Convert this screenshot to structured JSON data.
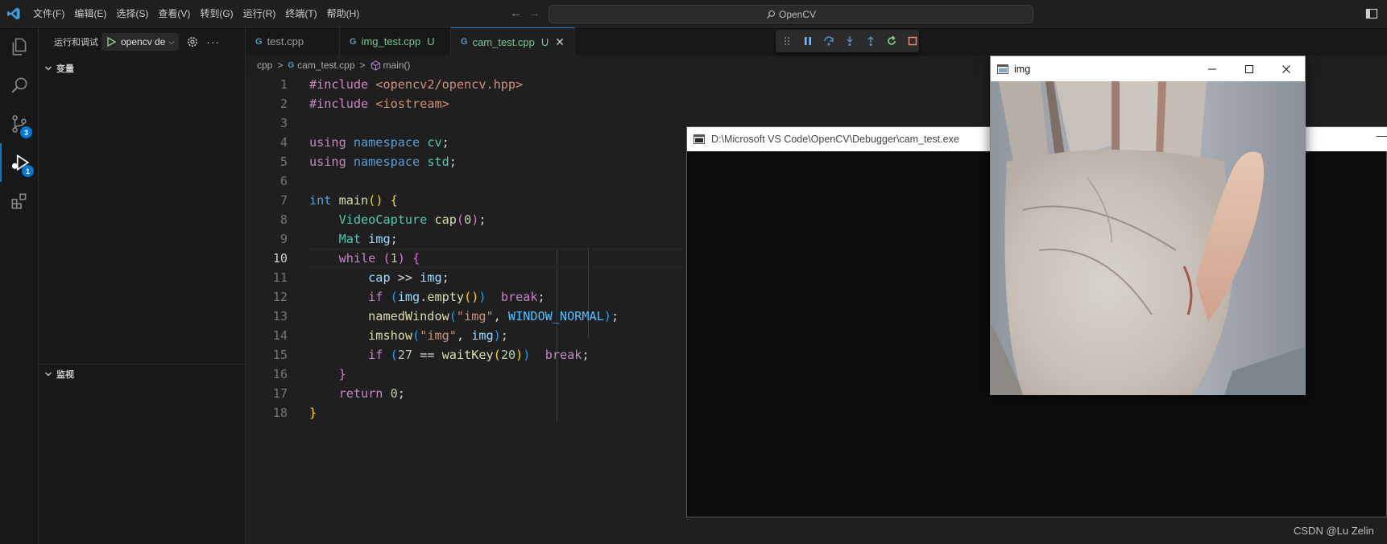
{
  "titlebar": {
    "menu": [
      "文件(F)",
      "编辑(E)",
      "选择(S)",
      "查看(V)",
      "转到(G)",
      "运行(R)",
      "终端(T)",
      "帮助(H)"
    ],
    "search_text": "OpenCV"
  },
  "activity_bar": {
    "source_control_badge": "3",
    "debug_badge": "1"
  },
  "sidebar": {
    "run_title": "运行和调试",
    "config_name": "opencv de",
    "variables_label": "变量",
    "watch_label": "监视"
  },
  "tabs": [
    {
      "name": "test.cpp",
      "modified": ""
    },
    {
      "name": "img_test.cpp",
      "modified": "U"
    },
    {
      "name": "cam_test.cpp",
      "modified": "U"
    }
  ],
  "breadcrumb": {
    "folder": "cpp",
    "file": "cam_test.cpp",
    "symbol": "main()"
  },
  "editor": {
    "current_line": 10,
    "line_numbers": [
      "1",
      "2",
      "3",
      "4",
      "5",
      "6",
      "7",
      "8",
      "9",
      "10",
      "11",
      "12",
      "13",
      "14",
      "15",
      "16",
      "17",
      "18"
    ]
  },
  "console_window": {
    "title": "D:\\Microsoft VS Code\\OpenCV\\Debugger\\cam_test.exe"
  },
  "img_window": {
    "title": "img"
  },
  "watermark": "CSDN @Lu Zelin",
  "colors": {
    "accent": "#0078d4",
    "editor_bg": "#1f1f1f",
    "sidebar_bg": "#181818"
  }
}
